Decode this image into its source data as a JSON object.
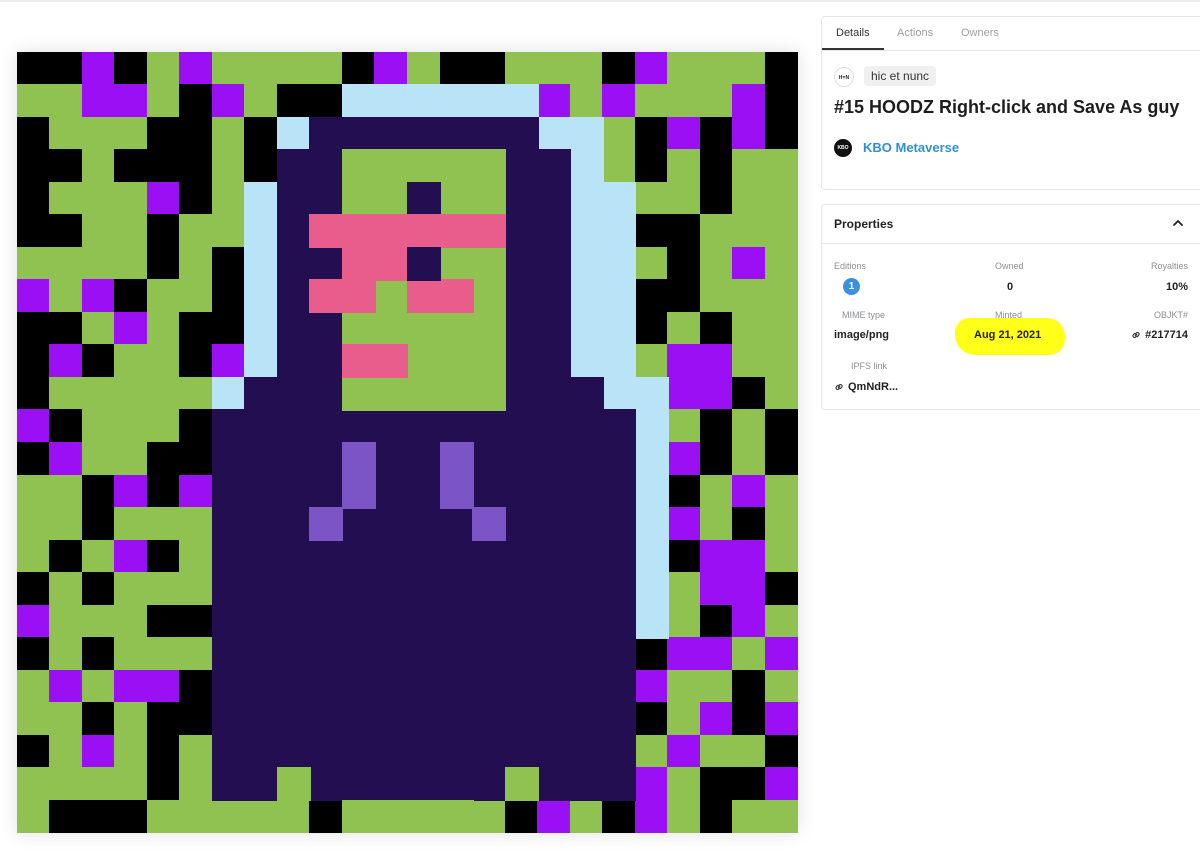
{
  "tabs": [
    {
      "label": "Details",
      "active": true
    },
    {
      "label": "Actions",
      "active": false
    },
    {
      "label": "Owners",
      "active": false
    }
  ],
  "platform": {
    "icon_text": "H=N",
    "name": "hic et nunc"
  },
  "token_title": "#15 HOODZ Right-click and Save As guy",
  "collection": {
    "icon_text": "KBO",
    "name": "KBO Metaverse"
  },
  "properties": {
    "title": "Properties",
    "editions_label": "Editions",
    "editions_value": "1",
    "owned_label": "Owned",
    "owned_value": "0",
    "royalties_label": "Royalties",
    "royalties_value": "10%",
    "mime_label": "MIME type",
    "mime_value": "image/png",
    "minted_label": "Minted",
    "minted_value": "Aug 21, 2021",
    "objkt_label": "OBJKT#",
    "objkt_value": "#217714",
    "ipfs_label": "IPFS link",
    "ipfs_value": "QmNdR..."
  },
  "colors": {
    "highlight": "#ffff1a",
    "link": "#2f8fdd",
    "badge": "#3d8fe0",
    "art_green": "#8fc251",
    "art_black": "#000000",
    "art_purple": "#9b0ff5",
    "art_hood": "#220e51",
    "art_sky": "#b9e4f8",
    "art_pink": "#e95d8d",
    "art_lilac": "#7b55c6"
  }
}
